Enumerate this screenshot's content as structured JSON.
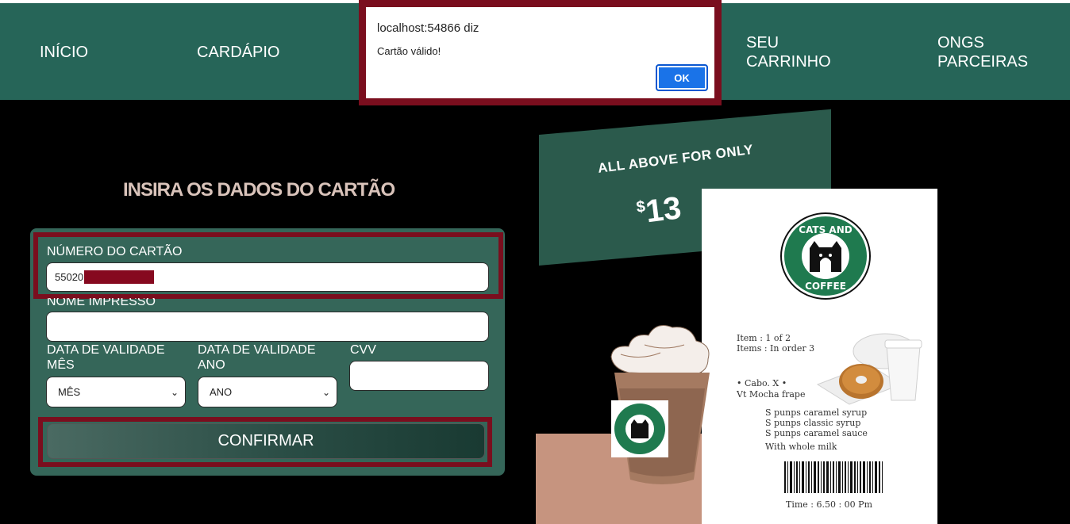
{
  "nav": {
    "inicio": "INÍCIO",
    "cardapio": "CARDÁPIO",
    "carrinho_line1": "SEU",
    "carrinho_line2": "CARRINHO",
    "ongs_line1": "ONGS",
    "ongs_line2": "PARCEIRAS"
  },
  "form": {
    "title": "INSIRA OS DADOS DO CARTÃO",
    "card_number_label": "NÚMERO DO CARTÃO",
    "card_number_value": "55020",
    "name_label": "NOME IMPRESSO",
    "name_value": "",
    "month_label_line1": "DATA DE VALIDADE",
    "month_label_line2": "MÊS",
    "month_selected": "MÊS",
    "year_label_line1": "DATA DE VALIDADE",
    "year_label_line2": "ANO",
    "year_selected": "ANO",
    "cvv_label": "CVV",
    "cvv_value": "",
    "confirm_label": "CONFIRMAR"
  },
  "promo": {
    "banner_text": "ALL ABOVE FOR ONLY",
    "price_symbol": "$",
    "price_value": "13",
    "logo_top_text": "CATS AND",
    "logo_bottom_text": "COFFEE",
    "receipt_lines": [
      "Item : 1 of 2",
      "Items : In order 3",
      "• Cabo. X •",
      "Vt Mocha frape",
      "S punps caramel syrup",
      "S punps classic syrup",
      "S punps caramel sauce",
      "With whole milk",
      "Time : 6.50 : 00 Pm"
    ]
  },
  "dialog": {
    "title": "localhost:54866 diz",
    "message": "Cartão válido!",
    "ok_label": "OK"
  },
  "colors": {
    "nav_bg": "#266558",
    "card_bg": "#356659",
    "highlight": "#7a0e1e",
    "title_color": "#d9c3ba",
    "ok_button": "#1a73e8"
  }
}
